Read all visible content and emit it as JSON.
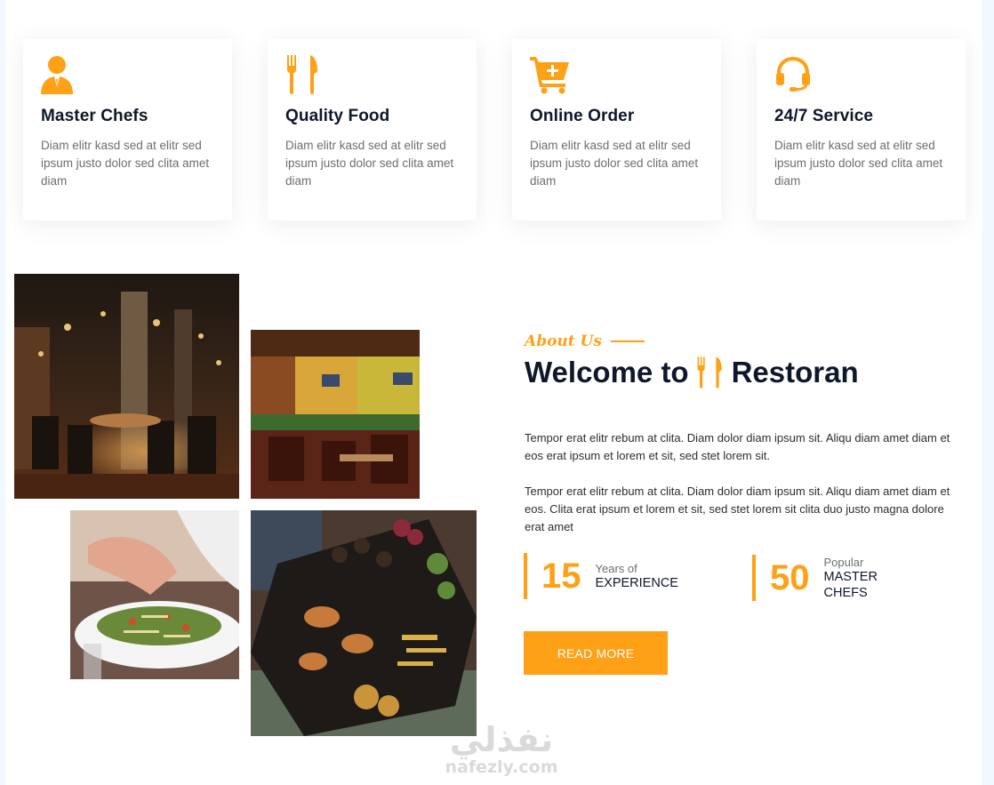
{
  "services": [
    {
      "icon": "chef-icon",
      "title": "Master Chefs",
      "text": "Diam elitr kasd sed at elitr sed ipsum justo dolor sed clita amet diam"
    },
    {
      "icon": "utensils-icon",
      "title": "Quality Food",
      "text": "Diam elitr kasd sed at elitr sed ipsum justo dolor sed clita amet diam"
    },
    {
      "icon": "cart-plus-icon",
      "title": "Online Order",
      "text": "Diam elitr kasd sed at elitr sed ipsum justo dolor sed clita amet diam"
    },
    {
      "icon": "headset-icon",
      "title": "24/7 Service",
      "text": "Diam elitr kasd sed at elitr sed ipsum justo dolor sed clita amet diam"
    }
  ],
  "about": {
    "label": "About Us",
    "title_before": "Welcome to",
    "title_after": "Restoran",
    "para1": "Tempor erat elitr rebum at clita. Diam dolor diam ipsum sit. Aliqu diam amet diam et eos erat ipsum et lorem et sit, sed stet lorem sit.",
    "para2": "Tempor erat elitr rebum at clita. Diam dolor diam ipsum sit. Aliqu diam amet diam et eos. Clita erat ipsum et lorem et sit, sed stet lorem sit clita duo justo magna dolore erat amet",
    "stats": [
      {
        "number": "15",
        "small": "Years of",
        "big": "Experience"
      },
      {
        "number": "50",
        "small": "Popular",
        "big": "Master Chefs"
      }
    ],
    "button": "Read More"
  },
  "watermark": {
    "arabic": "نفذلي",
    "latin": "nafezly.com"
  },
  "colors": {
    "accent": "#FEA116",
    "dark": "#0F172B",
    "muted": "#6B6E73",
    "background": "#F1F8FF"
  }
}
